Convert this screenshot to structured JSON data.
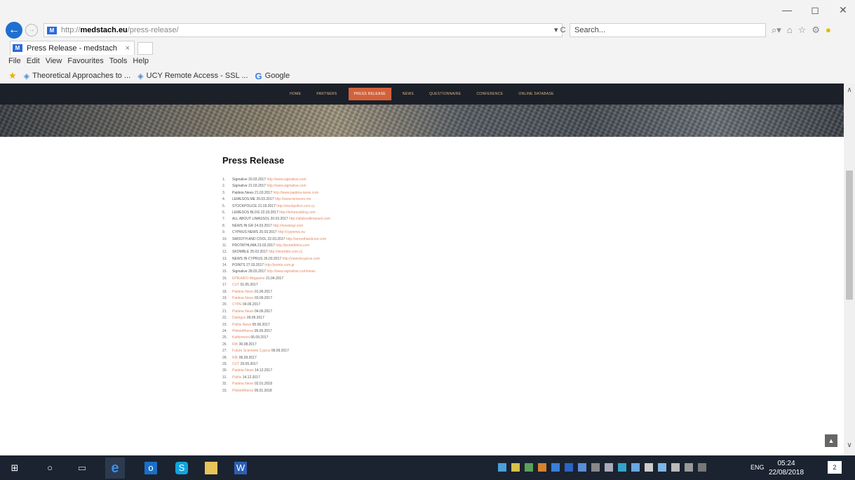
{
  "window": {
    "minimize": "—",
    "maximize": "◻",
    "close": "✕"
  },
  "address": {
    "url_prefix": "http://",
    "url_domain": "medstach.eu",
    "url_path": "/press-release/",
    "tools": "▾ C",
    "search_placeholder": "Search..."
  },
  "tab": {
    "title": "Press Release - medstach",
    "close": "×"
  },
  "menu": [
    "File",
    "Edit",
    "View",
    "Favourites",
    "Tools",
    "Help"
  ],
  "favourites": [
    {
      "label": "Theoretical Approaches to ..."
    },
    {
      "label": "UCY Remote Access - SSL ..."
    },
    {
      "label": "Google"
    }
  ],
  "site_nav": [
    {
      "label": "Home",
      "active": false
    },
    {
      "label": "Partners",
      "active": false
    },
    {
      "label": "Press Release",
      "active": true
    },
    {
      "label": "News",
      "active": false
    },
    {
      "label": "Questionnaire",
      "active": false
    },
    {
      "label": "Conference",
      "active": false
    },
    {
      "label": "Online Database",
      "active": false
    }
  ],
  "page": {
    "title": "Press Release"
  },
  "press_items": [
    {
      "num": "1.",
      "text": "Sigmalive 20.03.2017",
      "link": "http://www.sigmalive.com"
    },
    {
      "num": "2.",
      "text": "Sigmalive 21.03.2017",
      "link": "http://www.sigmalive.com"
    },
    {
      "num": "3.",
      "text": "Paideia News 21.03.2017",
      "link": "http://www.paideia-news.com"
    },
    {
      "num": "4.",
      "text": "LEMESOS.ME 20.03.2017",
      "link": "http://www.lemesos.me"
    },
    {
      "num": "5.",
      "text": "STOCKPOLICE 21.03.2017",
      "link": "http://stockpolice.com.cy"
    },
    {
      "num": "6.",
      "text": "LEMESOS BLOG 22.03.2017",
      "link": "http://lemesosblog.com"
    },
    {
      "num": "7.",
      "text": "ALL ABOUT LIMASSOL 20.03.2017",
      "link": "http://allaboutlimassol.com"
    },
    {
      "num": "8.",
      "text": "NEWS IN GR 24.03.2017",
      "link": "http://newsingr.com"
    },
    {
      "num": "9.",
      "text": "CYPRUS NEWS 20.03.2017",
      "link": "http://cypnews.eu"
    },
    {
      "num": "10.",
      "text": "SMOOTH AND COOL 22.03.2017",
      "link": "http://smoothandcool.com"
    },
    {
      "num": "11.",
      "text": "PROTATHLIMA 23.03.2017",
      "link": "http://protathlima.com"
    },
    {
      "num": "12.",
      "text": "SKOMBLE 25.03.2017",
      "link": "http://skomble.com.cy"
    },
    {
      "num": "13.",
      "text": "NEWS IN CYPRUS 26.03.2017",
      "link": "http://newsincyprus.com"
    },
    {
      "num": "14.",
      "text": "POINTS 27.03.2017",
      "link": "http://points.com.gr"
    },
    {
      "num": "15.",
      "text": "Sigmalive 28.03.2017",
      "link": "http://www.sigmalive.com/news"
    },
    {
      "num": "16.",
      "link": "EPIKAIRO Magazine",
      "text": "21.04.2017"
    },
    {
      "num": "17.",
      "link": "CUT",
      "text": "01.05.2017"
    },
    {
      "num": "18.",
      "link": "Paideia News",
      "text": "01.06.2017"
    },
    {
      "num": "19.",
      "link": "Paideia News",
      "text": "03.06.2017"
    },
    {
      "num": "20.",
      "link": "CYPE",
      "text": "04.06.2017"
    },
    {
      "num": "21.",
      "link": "Paideia News",
      "text": "04.06.2017"
    },
    {
      "num": "22.",
      "link": "Dialogos",
      "text": "09.06.2017"
    },
    {
      "num": "23.",
      "link": "Politis News",
      "text": "05.06.2017"
    },
    {
      "num": "24.",
      "link": "Phileleftheros",
      "text": "05.09.2017"
    },
    {
      "num": "25.",
      "link": "Kathimerini",
      "text": "06.09.2017"
    },
    {
      "num": "26.",
      "link": "RIK",
      "text": "30.08.2017"
    },
    {
      "num": "27.",
      "link": "Future Scientists Cyprus",
      "text": "06.09.2017"
    },
    {
      "num": "28.",
      "link": "RIK",
      "text": "06.09.2017"
    },
    {
      "num": "29.",
      "link": "CUT",
      "text": "29.09.2017"
    },
    {
      "num": "30.",
      "link": "Paideia News",
      "text": "14.12.2017"
    },
    {
      "num": "31.",
      "link": "Politis",
      "text": "14.12.2017"
    },
    {
      "num": "32.",
      "link": "Paideia News",
      "text": "02.01.2018"
    },
    {
      "num": "33.",
      "link": "Phileleftheros",
      "text": "05.01.2018"
    }
  ],
  "taskbar": {
    "lang": "ENG",
    "time": "05:24",
    "date": "22/08/2018",
    "notif": "2"
  },
  "colors": {
    "accent_nav": "#d2623b",
    "link": "#e08a66",
    "nav_bg": "#1c2029",
    "taskbar_bg": "#1b2330"
  }
}
